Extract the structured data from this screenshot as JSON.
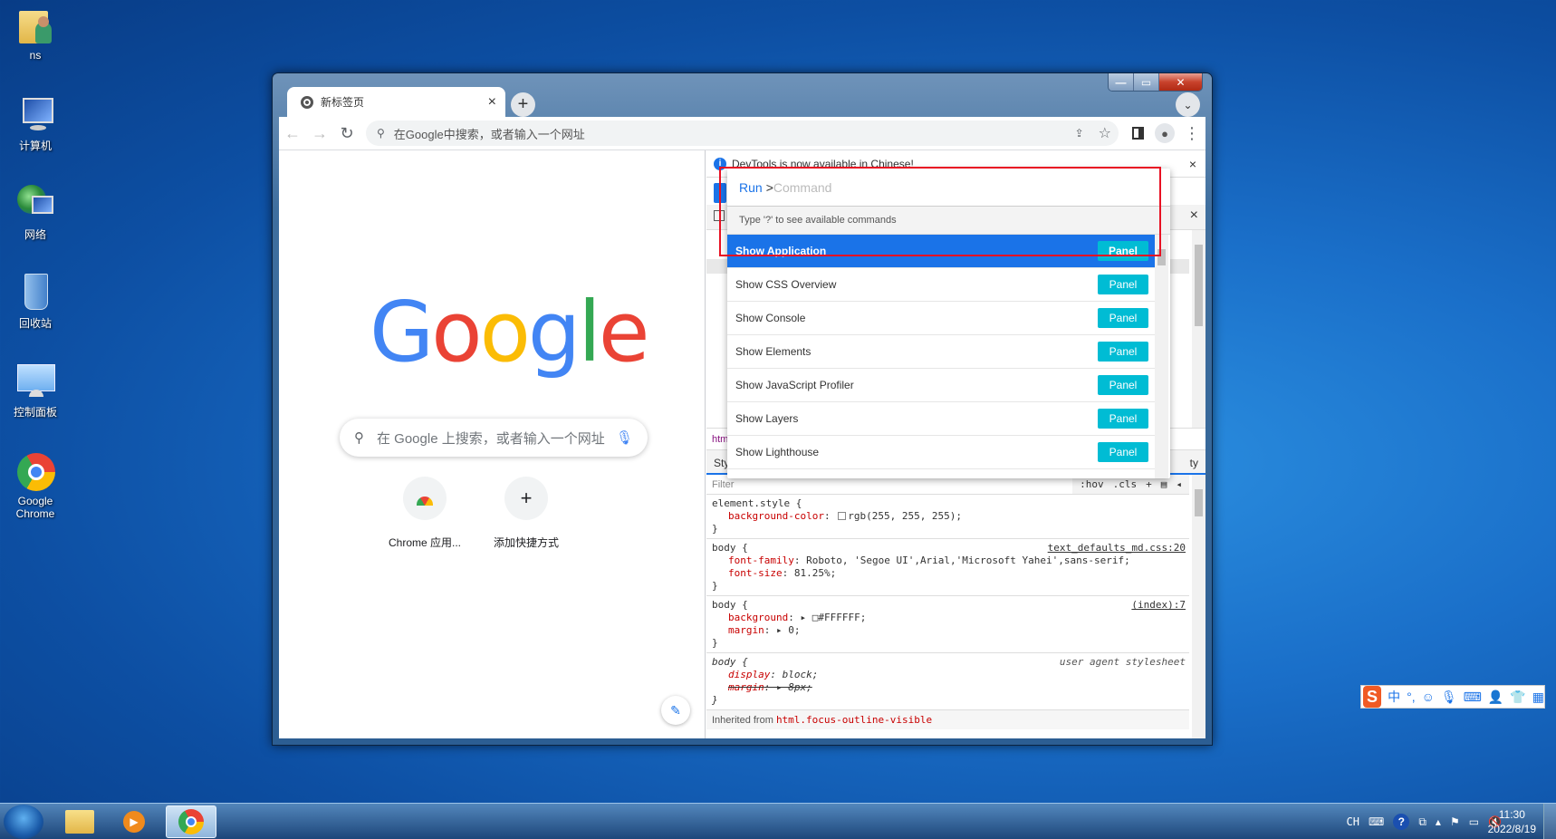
{
  "desktop": {
    "icons": [
      {
        "label": "ns",
        "icon": "user-folder-icon"
      },
      {
        "label": "计算机",
        "icon": "computer-icon"
      },
      {
        "label": "网络",
        "icon": "network-icon"
      },
      {
        "label": "回收站",
        "icon": "recycle-bin-icon"
      },
      {
        "label": "控制面板",
        "icon": "control-panel-icon"
      },
      {
        "label": "Google Chrome",
        "icon": "chrome-icon"
      }
    ]
  },
  "browser": {
    "tab": {
      "title": "新标签页",
      "close": "×"
    },
    "new_tab": "+",
    "tab_search": "⌄",
    "omnibox_placeholder": "在Google中搜索，或者输入一个网址",
    "window_controls": {
      "minimize": "—",
      "maximize": "▭",
      "close": "✕"
    }
  },
  "ntp": {
    "logo": [
      "G",
      "o",
      "o",
      "g",
      "l",
      "e"
    ],
    "logo_colors": [
      "#4285f4",
      "#ea4335",
      "#fbbc05",
      "#4285f4",
      "#34a853",
      "#ea4335"
    ],
    "search_placeholder": "在 Google 上搜索，或者输入一个网址",
    "shortcuts": [
      {
        "label": "Chrome 应用...",
        "icon": "chrome-web-store-icon"
      },
      {
        "label": "添加快捷方式",
        "icon": "plus-icon",
        "glyph": "+"
      }
    ]
  },
  "devtools": {
    "info_banner": "DevTools is now available in Chinese!",
    "breadcrumb": "html",
    "subtab": "Styles",
    "subtab_right": "ty",
    "filter_placeholder": "Filter",
    "filter_tools": [
      ":hov",
      ".cls",
      "+"
    ],
    "styles": [
      {
        "selector": "element.style {",
        "source": "",
        "props": [
          {
            "name": "background-color",
            "value": "rgb(255, 255, 255);",
            "swatch": true
          }
        ]
      },
      {
        "selector": "body {",
        "source": "text_defaults_md.css:20",
        "props": [
          {
            "name": "font-family",
            "value": "Roboto, 'Segoe UI',Arial,'Microsoft Yahei',sans-serif;"
          },
          {
            "name": "font-size",
            "value": "81.25%;"
          }
        ]
      },
      {
        "selector": "body {",
        "source": "(index):7",
        "props": [
          {
            "name": "background",
            "value": "▸ □#FFFFFF;"
          },
          {
            "name": "margin",
            "value": "▸ 0;"
          }
        ]
      },
      {
        "selector": "body {",
        "source": "user agent stylesheet",
        "props": [
          {
            "name": "display",
            "value": "block;"
          },
          {
            "name": "margin",
            "value": "▸ 8px;",
            "overridden": true
          }
        ]
      }
    ],
    "inherited_label": "Inherited from",
    "inherited_selector": "html.focus-outline-visible",
    "close": "×"
  },
  "command_menu": {
    "prefix": "Run",
    "arrow": ">",
    "placeholder": "Command",
    "hint": "Type '?' to see available commands",
    "items": [
      {
        "label": "Show Application",
        "badge": "Panel",
        "selected": true
      },
      {
        "label": "Show CSS Overview",
        "badge": "Panel"
      },
      {
        "label": "Show Console",
        "badge": "Panel"
      },
      {
        "label": "Show Elements",
        "badge": "Panel"
      },
      {
        "label": "Show JavaScript Profiler",
        "badge": "Panel"
      },
      {
        "label": "Show Layers",
        "badge": "Panel"
      },
      {
        "label": "Show Lighthouse",
        "badge": "Panel"
      }
    ]
  },
  "ime_bar": {
    "mode": "中",
    "punct": "°,"
  },
  "taskbar": {
    "apps": [
      "file-explorer-icon",
      "media-player-icon",
      "chrome-icon"
    ],
    "tray": {
      "lang": "CH"
    },
    "clock": {
      "time": "11:30",
      "date": "2022/8/19"
    }
  }
}
